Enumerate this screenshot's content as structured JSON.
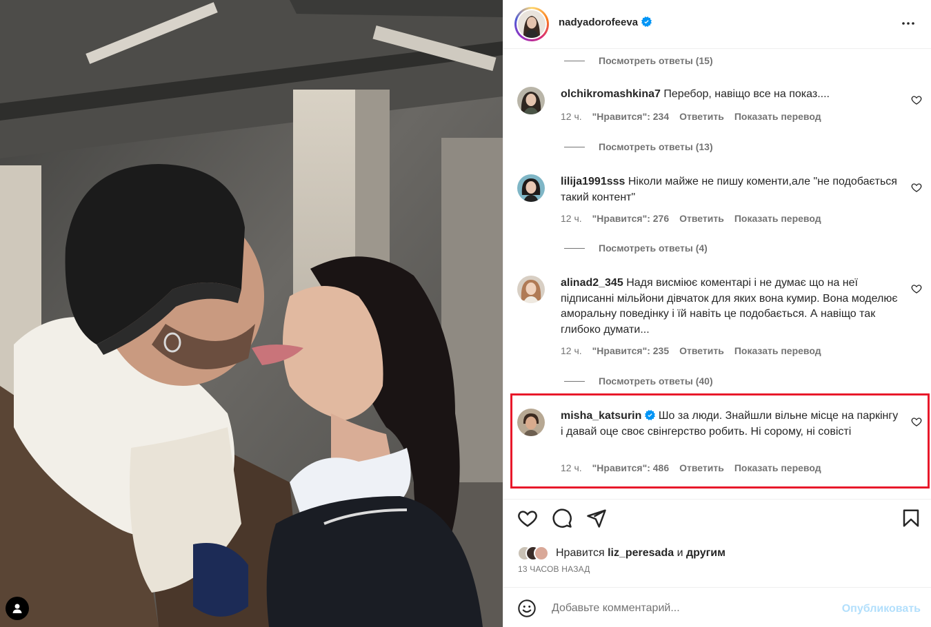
{
  "post": {
    "author": "nadyadorofeeva",
    "verified_icon": "verified-badge-icon",
    "more_icon": "more-options-icon"
  },
  "comments": [
    {
      "replies": "Посмотреть ответы (15)"
    },
    {
      "user": "olchikromashkina7",
      "text": "Перебор, навіщо все на показ....",
      "time": "12 ч.",
      "likes": "\"Нравится\": 234",
      "reply": "Ответить",
      "translate": "Показать перевод",
      "replies": "Посмотреть ответы (13)"
    },
    {
      "user": "lilija1991sss",
      "text": "Ніколи майже не пишу коменти,але \"не подобається такий контент\"",
      "time": "12 ч.",
      "likes": "\"Нравится\": 276",
      "reply": "Ответить",
      "translate": "Показать перевод",
      "replies": "Посмотреть ответы (4)"
    },
    {
      "user": "alinad2_345",
      "text": "Надя висміює коментарі і не думає що на неї підписанні мільйони дівчаток для яких вона кумир. Вона моделює аморальну поведінку і їй навіть це подобається. А навіщо так глибоко думати...",
      "time": "12 ч.",
      "likes": "\"Нравится\": 235",
      "reply": "Ответить",
      "translate": "Показать перевод",
      "replies": "Посмотреть ответы (40)"
    },
    {
      "user": "misha_katsurin",
      "verified": true,
      "text": "Шо за люди. Знайшли вільне місце на паркінгу і давай оце своє свінгерство робить. Ні сорому, ні совісті",
      "time": "12 ч.",
      "likes": "\"Нравится\": 486",
      "reply": "Ответить",
      "translate": "Показать перевод"
    }
  ],
  "likes_summary": {
    "prefix": "Нравится",
    "user": "liz_peresada",
    "connector": "и",
    "suffix": "другим"
  },
  "timestamp": "13 ЧАСОВ НАЗАД",
  "add_comment": {
    "placeholder": "Добавьте комментарий...",
    "publish": "Опубликовать"
  },
  "colors": {
    "highlight": "#e8182a",
    "verified": "#0095f6",
    "publish_disabled": "#b2dffc",
    "muted_text": "#737373"
  }
}
